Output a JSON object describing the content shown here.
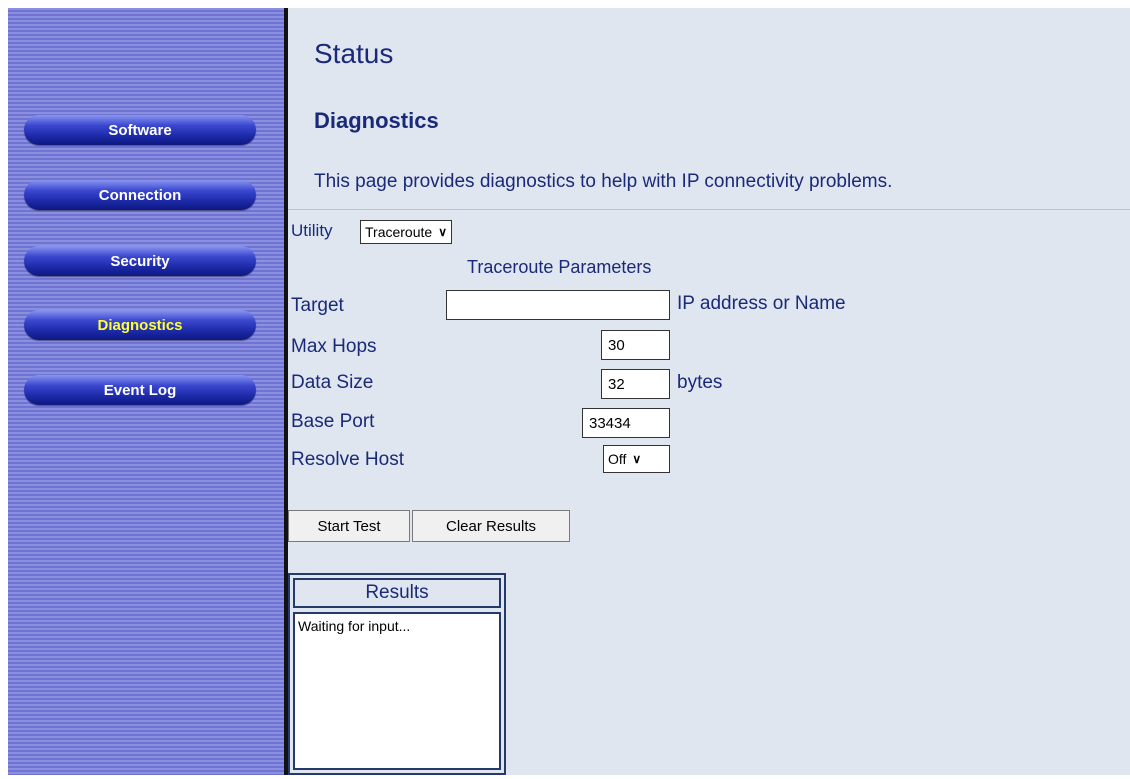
{
  "sidebar": {
    "items": [
      {
        "label": "Software"
      },
      {
        "label": "Connection"
      },
      {
        "label": "Security"
      },
      {
        "label": "Diagnostics"
      },
      {
        "label": "Event Log"
      }
    ],
    "active_item": "Diagnostics"
  },
  "header": {
    "title": "Status",
    "section": "Diagnostics",
    "description": "This page provides diagnostics to help with IP connectivity problems."
  },
  "form": {
    "utility_label": "Utility",
    "utility_value": "Traceroute",
    "params_heading": "Traceroute Parameters",
    "target_label": "Target",
    "target_value": "",
    "target_hint": "IP address or Name",
    "max_hops_label": "Max Hops",
    "max_hops_value": "30",
    "data_size_label": "Data Size",
    "data_size_value": "32",
    "data_size_unit": "bytes",
    "base_port_label": "Base Port",
    "base_port_value": "33434",
    "resolve_host_label": "Resolve Host",
    "resolve_host_value": "Off"
  },
  "buttons": {
    "start_test": "Start Test",
    "clear_results": "Clear Results"
  },
  "results": {
    "heading": "Results",
    "text": "Waiting for input..."
  },
  "colors": {
    "text": "#1a2a78",
    "main_bg": "#dfe6f0",
    "active_nav_text": "#ffff33"
  },
  "icons": {
    "dropdown": "chevron-down-icon"
  }
}
